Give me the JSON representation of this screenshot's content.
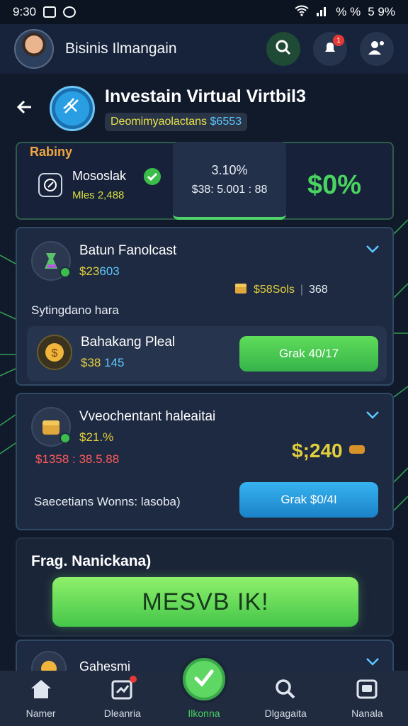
{
  "status_bar": {
    "time": "9:30",
    "battery": "5 9%",
    "misc": "% %"
  },
  "header": {
    "title": "Bisinis Ilmangain",
    "notification_count": "1"
  },
  "page": {
    "title": "Investain Virtual Virtbil3",
    "subtitle_text": "Deomimyaolactans",
    "subtitle_amount": "$6553"
  },
  "stats": {
    "ranking_label": "Rabiny",
    "item_name": "Mososlak",
    "item_meta": "Mles 2,488",
    "percent": "3.10%",
    "value": "$38: 5.001 : 88",
    "big_value": "$0%"
  },
  "card1": {
    "title": "Batun Fanolcast",
    "amount": "$23",
    "amount_blue": "603",
    "side_value": "$58Sols",
    "side_extra": "368",
    "section_label": "Sytingdano hara",
    "sub_title": "Bahakang Pleal",
    "sub_amount": "$38",
    "sub_amount_blue": "145",
    "button": "Grak 40/17"
  },
  "card2": {
    "title": "Vveochentant haleaitai",
    "amount": "$21.%",
    "red_value": "$1358 : 38.5.88",
    "big_value": "$;240",
    "footer_text": "Saecetians Wonns: lasoba)",
    "button": "Grak $0/4I"
  },
  "cta": {
    "label": "Frag. Nanickana)",
    "button": "MESVB IK!"
  },
  "peek": {
    "label": "Gahesmi"
  },
  "nav": {
    "items": [
      {
        "label": "Namer"
      },
      {
        "label": "Dleanria"
      },
      {
        "label": "Ilkonna"
      },
      {
        "label": "Dlgagaita"
      },
      {
        "label": "Nanala"
      }
    ]
  },
  "colors": {
    "accent_green": "#4ad35f",
    "accent_blue": "#2a9ee3",
    "background": "#111a2b",
    "gold": "#e3cf3c"
  }
}
